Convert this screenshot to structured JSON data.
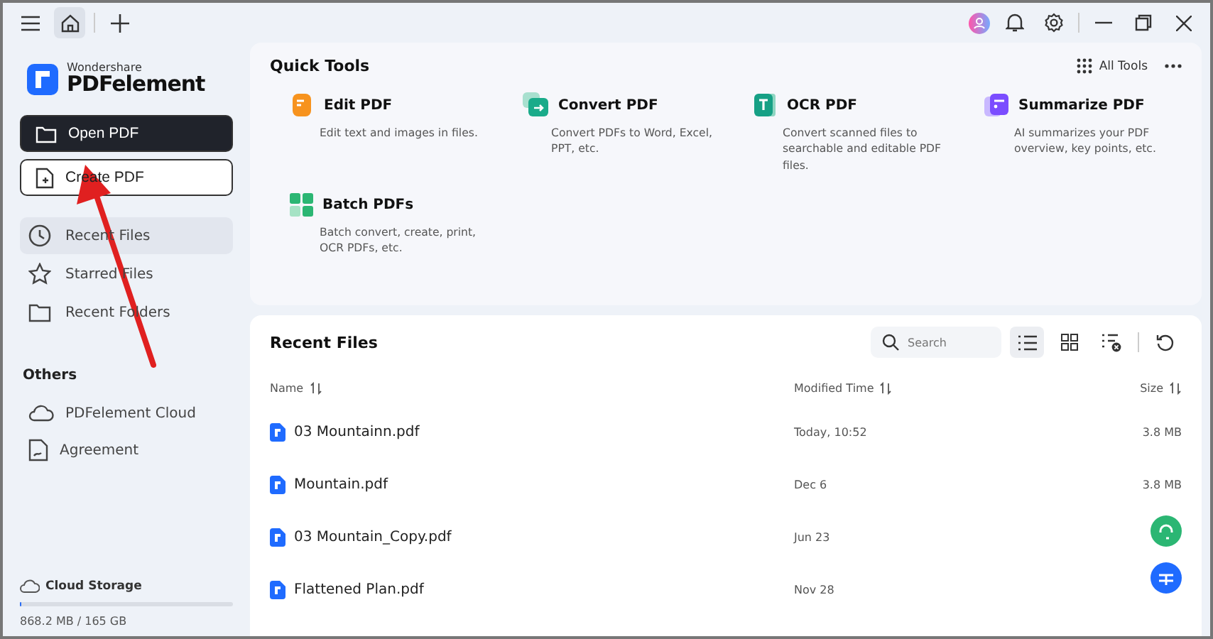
{
  "brand": {
    "company": "Wondershare",
    "product": "PDFelement"
  },
  "actions": [
    {
      "label": "Open PDF",
      "kind": "open",
      "selected": true
    },
    {
      "label": "Create PDF",
      "kind": "create",
      "selected": false
    }
  ],
  "nav": [
    {
      "label": "Recent Files",
      "kind": "recent",
      "selected": true
    },
    {
      "label": "Starred Files",
      "kind": "starred",
      "selected": false
    },
    {
      "label": "Recent Folders",
      "kind": "folder",
      "selected": false
    }
  ],
  "others": {
    "title": "Others",
    "items": [
      {
        "label": "PDFelement Cloud",
        "kind": "cloud"
      },
      {
        "label": "Agreement",
        "kind": "agreement"
      }
    ]
  },
  "storage": {
    "title": "Cloud Storage",
    "level": 0.005,
    "usage": "868.2 MB / 165 GB"
  },
  "quick_tools": {
    "title": "Quick Tools",
    "all_tools": "All Tools",
    "tools": [
      {
        "name": "Edit PDF",
        "description": "Edit text and images in files.",
        "kind": "edit"
      },
      {
        "name": "Convert PDF",
        "description": "Convert PDFs to Word, Excel, PPT, etc.",
        "kind": "convert"
      },
      {
        "name": "OCR PDF",
        "description": "Convert scanned files to searchable and editable PDF files.",
        "kind": "ocr"
      },
      {
        "name": "Summarize PDF",
        "description": "AI summarizes your PDF overview, key points, etc.",
        "kind": "summarize"
      },
      {
        "name": "Batch PDFs",
        "description": "Batch convert, create, print, OCR PDFs, etc.",
        "kind": "batch"
      }
    ]
  },
  "recent_files": {
    "title": "Recent Files",
    "search": {
      "placeholder": "Search"
    },
    "views": [
      {
        "kind": "list",
        "selected": true
      },
      {
        "kind": "grid",
        "selected": false
      }
    ],
    "columns": [
      "Name",
      "Modified Time",
      "Size"
    ],
    "rows": [
      {
        "name": "03 Mountainn.pdf",
        "modified": "Today, 10:52",
        "size": "3.8 MB"
      },
      {
        "name": "Mountain.pdf",
        "modified": "Dec 6",
        "size": "3.8 MB"
      },
      {
        "name": "03 Mountain_Copy.pdf",
        "modified": "Jun 23"
      },
      {
        "name": "Flattened Plan.pdf",
        "modified": "Nov 28"
      }
    ]
  }
}
